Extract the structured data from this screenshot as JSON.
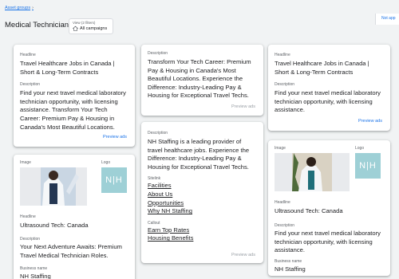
{
  "header": {
    "breadcrumb": "Asset groups",
    "breadcrumb_chevron": "›",
    "title": "Medical Technician",
    "view_label": "View (2 filters)",
    "view_value": "All campaigns",
    "side_button": "Not app"
  },
  "col1": {
    "card1": {
      "headline_label": "Headline",
      "headline": "Travel Healthcare Jobs in Canada | Short & Long-Term Contracts",
      "description_label": "Description",
      "description": "Find your next travel medical laboratory technician opportunity, with licensing assistance. Transform Your Tech Career: Premium Pay & Housing in Canada's Most Beautiful Locations.",
      "preview": "Preview ads"
    },
    "card2": {
      "image_label": "Image",
      "logo_label": "Logo",
      "logo_text": "N|H",
      "headline_label": "Headline",
      "headline": "Ultrasound Tech: Canada",
      "description_label": "Description",
      "description": "Your Next Adventure Awaits: Premium Travel Medical Technician Roles.",
      "business_label": "Business name",
      "business": "NH Staffing"
    }
  },
  "col2": {
    "card1": {
      "description_label": "Description",
      "description": "Transform Your Tech Career: Premium Pay & Housing in Canada's Most Beautiful Locations. Experience the Difference: Industry-Leading Pay & Housing for Exceptional Travel Techs.",
      "preview": "Preview ads"
    },
    "card2": {
      "description_label": "Description",
      "description": "NH Staffing is a leading provider of travel healthcare jobs. Experience the Difference: Industry-Leading Pay & Housing for Exceptional Travel Techs.",
      "sitelink_label": "Sitelink",
      "sitelinks": [
        "Facilities",
        "About Us",
        "Opportunities",
        "Why NH Staffing"
      ],
      "callout_label": "Callout",
      "callouts": [
        "Earn Top Rates",
        "Housing Benefits"
      ],
      "preview": "Preview ads"
    }
  },
  "col3": {
    "card1": {
      "headline_label": "Headline",
      "headline": "Travel Healthcare Jobs in Canada | Short & Long-Term Contracts",
      "description_label": "Description",
      "description": "Find your next travel medical laboratory technician opportunity, with licensing assistance.",
      "preview": "Preview ads"
    },
    "card2": {
      "image_label": "Image",
      "logo_label": "Logo",
      "logo_text": "N|H",
      "headline_label": "Headline",
      "headline": "Ultrasound Tech: Canada",
      "description_label": "Description",
      "description": "Find your next travel medical laboratory technician opportunity, with licensing assistance.",
      "business_label": "Business name",
      "business": "NH Staffing"
    }
  },
  "colors": {
    "link": "#1a73e8",
    "disabled": "#9aa0a6",
    "logo_bg": "#9ed0d6",
    "background": "#f1f3f4"
  }
}
